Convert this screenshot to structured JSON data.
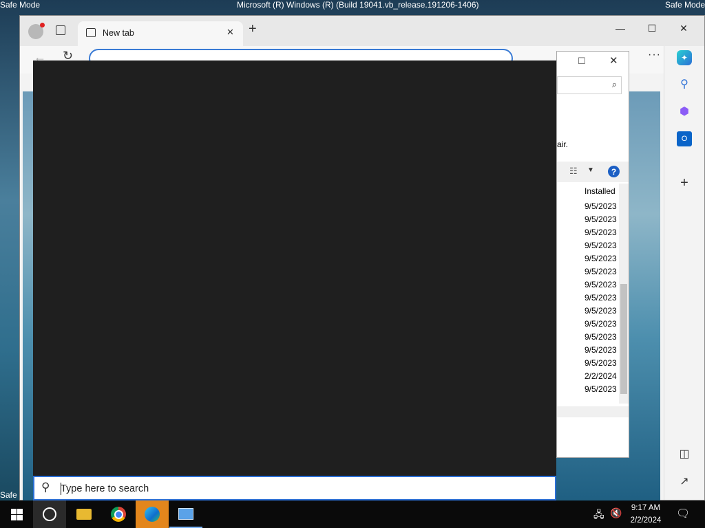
{
  "desktop": {
    "safe_mode_left": "Safe Mode",
    "safe_mode_right": "Safe Mode",
    "safe_mode_bottom_left": "Safe",
    "build_text": "Microsoft (R) Windows (R) (Build 19041.vb_release.191206-1406)"
  },
  "browser": {
    "tab_title": "New tab",
    "new_tab_symbol": "+",
    "close_symbol": "✕",
    "minimize_symbol": "—",
    "maximize_symbol": "☐",
    "window_close_symbol": "✕",
    "more_symbol": "···"
  },
  "programs": {
    "repair_fragment": "air.",
    "column_installed": "Installed",
    "installed_dates": [
      "9/5/2023",
      "9/5/2023",
      "9/5/2023",
      "9/5/2023",
      "9/5/2023",
      "9/5/2023",
      "9/5/2023",
      "9/5/2023",
      "9/5/2023",
      "9/5/2023",
      "9/5/2023",
      "9/5/2023",
      "9/5/2023",
      "2/2/2024",
      "9/5/2023"
    ],
    "help_symbol": "?"
  },
  "search": {
    "placeholder": "Type here to search"
  },
  "taskbar": {
    "time": "9:17 AM",
    "date": "2/2/2024"
  },
  "colors": {
    "accent": "#2b6fd6",
    "taskbar": "#0a0a0a",
    "search_panel": "#1f1f1f",
    "edge_selected_tab": "#e3861c"
  }
}
